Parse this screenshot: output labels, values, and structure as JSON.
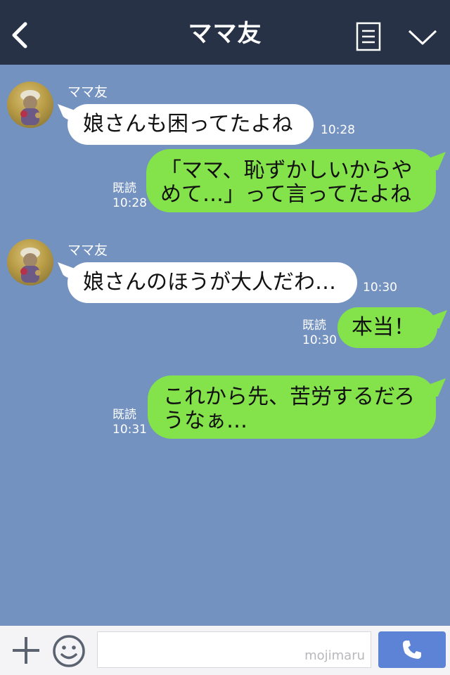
{
  "header": {
    "title": "ママ友"
  },
  "messages": [
    {
      "from": "friend",
      "sender": "ママ友",
      "lines": [
        "娘さんも困ってたよね"
      ],
      "time": "10:28"
    },
    {
      "from": "me",
      "lines": [
        "「ママ、恥ずかしいからや",
        "めて…」って言ってたよね"
      ],
      "read": "既読",
      "time": "10:28"
    },
    {
      "from": "friend",
      "sender": "ママ友",
      "lines": [
        "娘さんのほうが大人だわ…"
      ],
      "time": "10:30"
    },
    {
      "from": "me",
      "lines": [
        "本当！"
      ],
      "read": "既読",
      "time": "10:30"
    },
    {
      "from": "me",
      "lines": [
        "これから先、苦労するだろ",
        "うなぁ…"
      ],
      "read": "既読",
      "time": "10:31"
    }
  ],
  "footer": {
    "watermark": "mojimaru"
  },
  "colors": {
    "header_bg": "#273246",
    "chat_bg": "#7392c0",
    "incoming_bubble": "#ffffff",
    "outgoing_bubble": "#84e24a",
    "call_button": "#5d83d6"
  },
  "icons": {
    "back": "chevron-left-icon",
    "menu": "menu-icon",
    "collapse": "chevron-down-icon",
    "add": "plus-icon",
    "emoji": "smiley-icon",
    "call": "phone-icon"
  }
}
